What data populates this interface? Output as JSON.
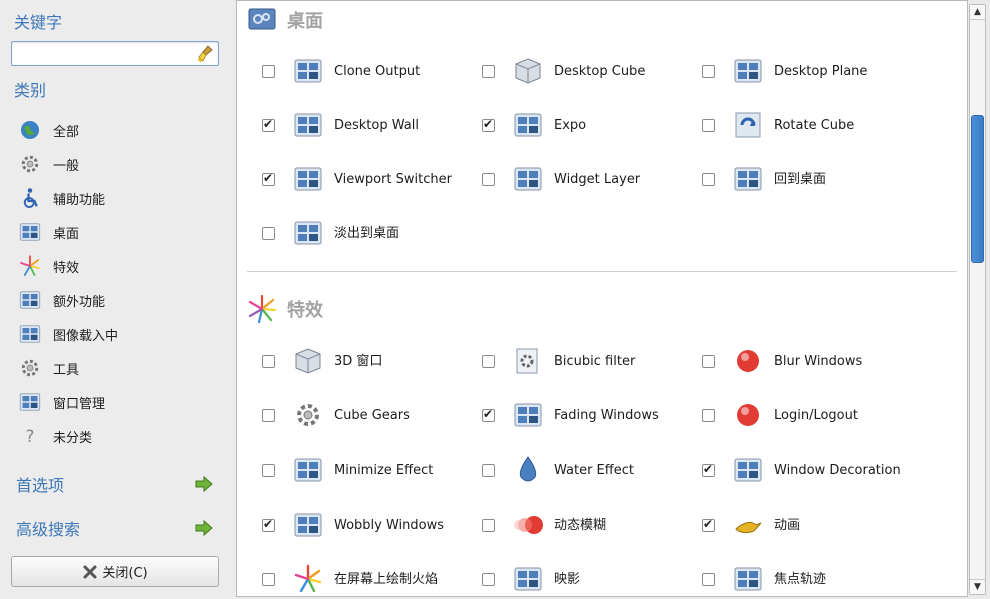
{
  "sidebar": {
    "keyword_heading": "关键字",
    "search_value": "",
    "category_heading": "类别",
    "categories": [
      {
        "label": "全部",
        "icon": "globe-icon"
      },
      {
        "label": "一般",
        "icon": "gear-icon"
      },
      {
        "label": "辅助功能",
        "icon": "accessibility-icon"
      },
      {
        "label": "桌面",
        "icon": "desktop-icon"
      },
      {
        "label": "特效",
        "icon": "effects-icon"
      },
      {
        "label": "额外功能",
        "icon": "extras-icon"
      },
      {
        "label": "图像载入中",
        "icon": "image-loading-icon"
      },
      {
        "label": "工具",
        "icon": "tools-icon"
      },
      {
        "label": "窗口管理",
        "icon": "window-management-icon"
      },
      {
        "label": "未分类",
        "icon": "question-icon"
      }
    ],
    "preferences_label": "首选项",
    "advanced_search_label": "高级搜索",
    "close_label": "关闭(C)"
  },
  "sections": {
    "desktop": {
      "title": "桌面",
      "plugins": [
        {
          "label": "Clone Output",
          "checked": false,
          "icon": "clone-output-icon"
        },
        {
          "label": "Desktop Cube",
          "checked": false,
          "icon": "desktop-cube-icon"
        },
        {
          "label": "Desktop Plane",
          "checked": false,
          "icon": "desktop-plane-icon"
        },
        {
          "label": "Desktop Wall",
          "checked": true,
          "icon": "desktop-wall-icon"
        },
        {
          "label": "Expo",
          "checked": true,
          "icon": "expo-icon"
        },
        {
          "label": "Rotate Cube",
          "checked": false,
          "icon": "rotate-cube-icon"
        },
        {
          "label": "Viewport Switcher",
          "checked": true,
          "icon": "viewport-switcher-icon"
        },
        {
          "label": "Widget Layer",
          "checked": false,
          "icon": "widget-layer-icon"
        },
        {
          "label": "回到桌面",
          "checked": false,
          "icon": "show-desktop-icon"
        },
        {
          "label": "淡出到桌面",
          "checked": false,
          "icon": "fade-desktop-icon"
        }
      ]
    },
    "effects": {
      "title": "特效",
      "plugins": [
        {
          "label": "3D 窗口",
          "checked": false,
          "icon": "3d-windows-icon"
        },
        {
          "label": "Bicubic filter",
          "checked": false,
          "icon": "bicubic-filter-icon"
        },
        {
          "label": "Blur Windows",
          "checked": false,
          "icon": "blur-windows-icon"
        },
        {
          "label": "Cube Gears",
          "checked": false,
          "icon": "cube-gears-icon"
        },
        {
          "label": "Fading Windows",
          "checked": true,
          "icon": "fading-windows-icon"
        },
        {
          "label": "Login/Logout",
          "checked": false,
          "icon": "login-logout-icon"
        },
        {
          "label": "Minimize Effect",
          "checked": false,
          "icon": "minimize-effect-icon"
        },
        {
          "label": "Water Effect",
          "checked": false,
          "icon": "water-effect-icon"
        },
        {
          "label": "Window Decoration",
          "checked": true,
          "icon": "window-decoration-icon"
        },
        {
          "label": "Wobbly Windows",
          "checked": true,
          "icon": "wobbly-windows-icon"
        },
        {
          "label": "动态模糊",
          "checked": false,
          "icon": "motion-blur-icon"
        },
        {
          "label": "动画",
          "checked": true,
          "icon": "animation-icon"
        },
        {
          "label": "在屏幕上绘制火焰",
          "checked": false,
          "icon": "fire-icon"
        },
        {
          "label": "映影",
          "checked": false,
          "icon": "reflection-icon"
        },
        {
          "label": "焦点轨迹",
          "checked": false,
          "icon": "focus-trail-icon"
        }
      ]
    }
  },
  "colors": {
    "accent": "#3e78b8",
    "scroll_thumb": "#3a7cc8"
  }
}
